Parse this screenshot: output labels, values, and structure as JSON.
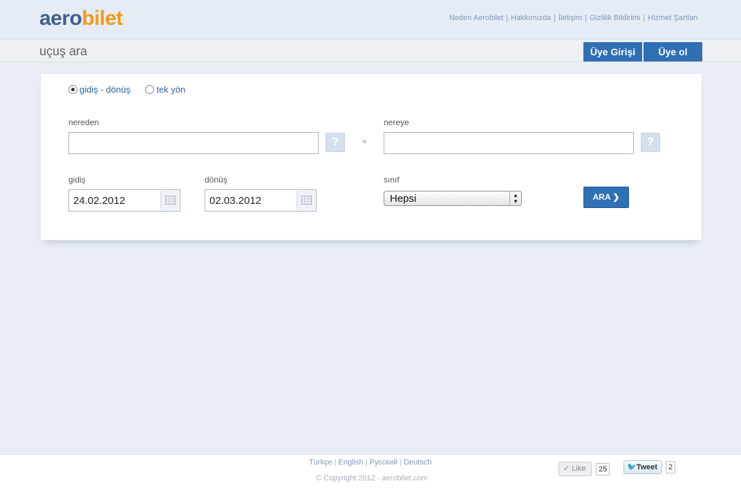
{
  "header": {
    "logo_part1": "aero",
    "logo_part2": "bilet",
    "links": [
      "Neden Aerobilet",
      "Hakkımızda",
      "İletişim",
      "Gizlilik Bildirimi",
      "Hizmet Şartları"
    ]
  },
  "subbar": {
    "title": "uçuş ara",
    "login_label": "Üye Girişi",
    "signup_label": "Üye ol"
  },
  "search": {
    "trip_roundtrip": "gidiş - dönüş",
    "trip_oneway": "tek yön",
    "selected_trip": "gidiş - dönüş",
    "from_label": "nereden",
    "from_value": "",
    "to_label": "nereye",
    "to_value": "",
    "help_glyph": "?",
    "swap_glyph": "‹›",
    "depart_label": "gidiş",
    "depart_value": "24.02.2012",
    "return_label": "dönüş",
    "return_value": "02.03.2012",
    "class_label": "sınıf",
    "class_value": "Hepsi",
    "search_button": "ARA",
    "search_button_arrow": "❯"
  },
  "footer": {
    "languages": [
      "Türkçe",
      "English",
      "Русский",
      "Deutsch"
    ],
    "copyright": "© Copyright 2012 - aerobilet.com",
    "like_label": "Like",
    "like_count": "25",
    "tweet_label": "Tweet",
    "tweet_count": "2"
  },
  "colors": {
    "brand_blue": "#3f5f8e",
    "brand_orange": "#f39a18",
    "button_blue": "#2f6fb4",
    "page_bg": "#e9eef6"
  }
}
